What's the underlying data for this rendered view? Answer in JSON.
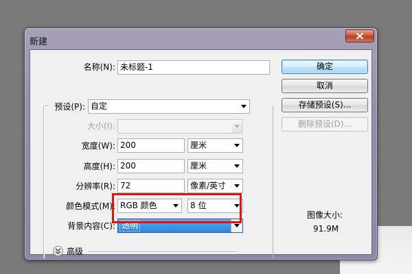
{
  "dialog": {
    "title": "新建"
  },
  "fields": {
    "name_label": "名称(N):",
    "name_value": "未标题-1",
    "preset_label": "预设(P):",
    "preset_value": "自定",
    "size_label": "大小(I):",
    "size_value": "",
    "width_label": "宽度(W):",
    "width_value": "200",
    "width_unit": "厘米",
    "height_label": "高度(H):",
    "height_value": "200",
    "height_unit": "厘米",
    "resolution_label": "分辨率(R):",
    "resolution_value": "72",
    "resolution_unit": "像素/英寸",
    "color_mode_label": "颜色模式(M):",
    "color_mode_value": "RGB 颜色",
    "bit_depth_value": "8 位",
    "background_label": "背景内容(C):",
    "background_value": "透明",
    "advanced_label": "高级"
  },
  "buttons": {
    "ok": "确定",
    "cancel": "取消",
    "save_preset": "存储预设(S)...",
    "delete_preset": "删除预设(D)..."
  },
  "info": {
    "image_size_label": "图像大小:",
    "image_size_value": "91.9M"
  },
  "colors": {
    "highlight_border": "#e01313",
    "selection": "#3399ff"
  },
  "icons": {
    "close": "close-icon",
    "expand": "chevron-double-down-icon"
  }
}
